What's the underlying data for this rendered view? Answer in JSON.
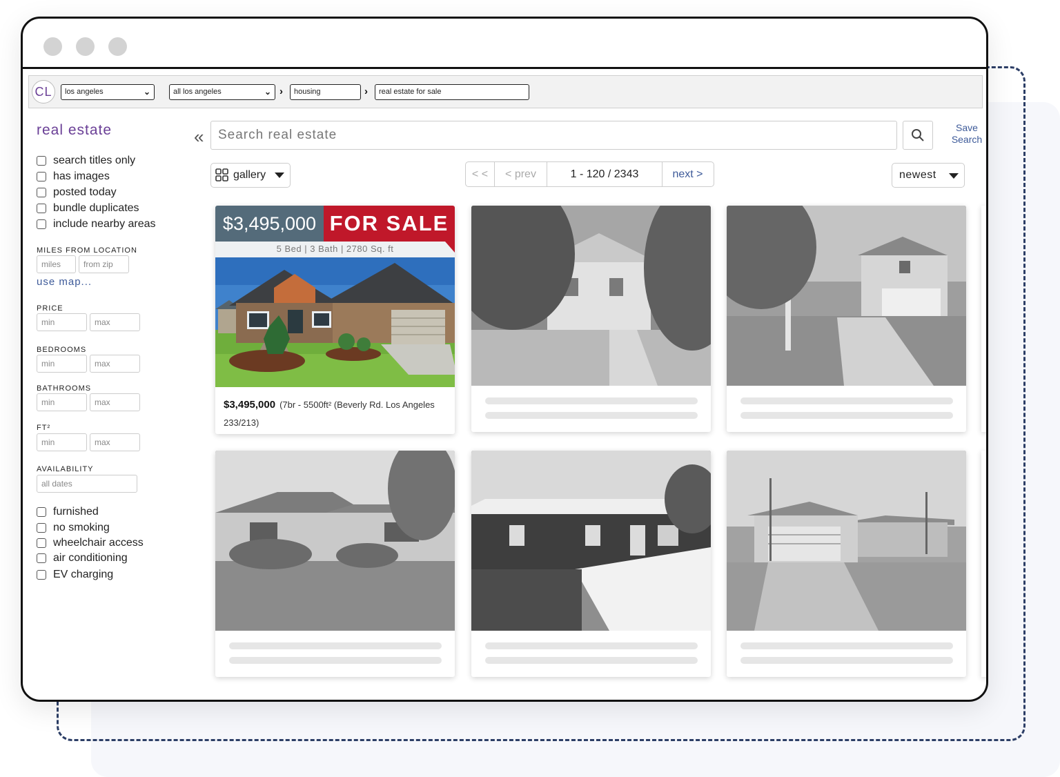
{
  "topbar": {
    "logo": "CL",
    "city_select": "los angeles",
    "area_select": "all los angeles",
    "category": "housing",
    "subcategory": "real estate for sale"
  },
  "sidebar": {
    "title": "real estate",
    "options": [
      "search titles only",
      "has images",
      "posted today",
      "bundle duplicates",
      "include nearby areas"
    ],
    "miles_label": "MILES FROM LOCATION",
    "miles_placeholder": "miles",
    "zip_placeholder": "from zip",
    "use_map": "use map...",
    "price_label": "PRICE",
    "bedrooms_label": "BEDROOMS",
    "bathrooms_label": "BATHROOMS",
    "ft_label": "FT²",
    "min_placeholder": "min",
    "max_placeholder": "max",
    "availability_label": "AVAILABILITY",
    "availability_value": "all dates",
    "amenities": [
      "furnished",
      "no smoking",
      "wheelchair access",
      "air conditioning",
      "EV charging"
    ]
  },
  "search": {
    "placeholder": "Search real estate",
    "save_line1": "Save",
    "save_line2": "Search"
  },
  "toolbar": {
    "view": "gallery",
    "first": "< <",
    "prev": "< prev",
    "range": "1 - 120 / 2343",
    "next": "next >",
    "sort": "newest"
  },
  "listing": {
    "price_banner": "$3,495,000",
    "sale_banner": "FOR SALE",
    "specs": "5 Bed | 3 Bath | 2780 Sq. ft",
    "price": "$3,495,000",
    "details": "(7br - 5500ft² (Beverly Rd. Los Angeles 233/213)"
  },
  "colors": {
    "brand_purple": "#6a3f96",
    "link_blue": "#3d5a99",
    "sale_red": "#c0182a",
    "price_slate": "#546b7a"
  }
}
